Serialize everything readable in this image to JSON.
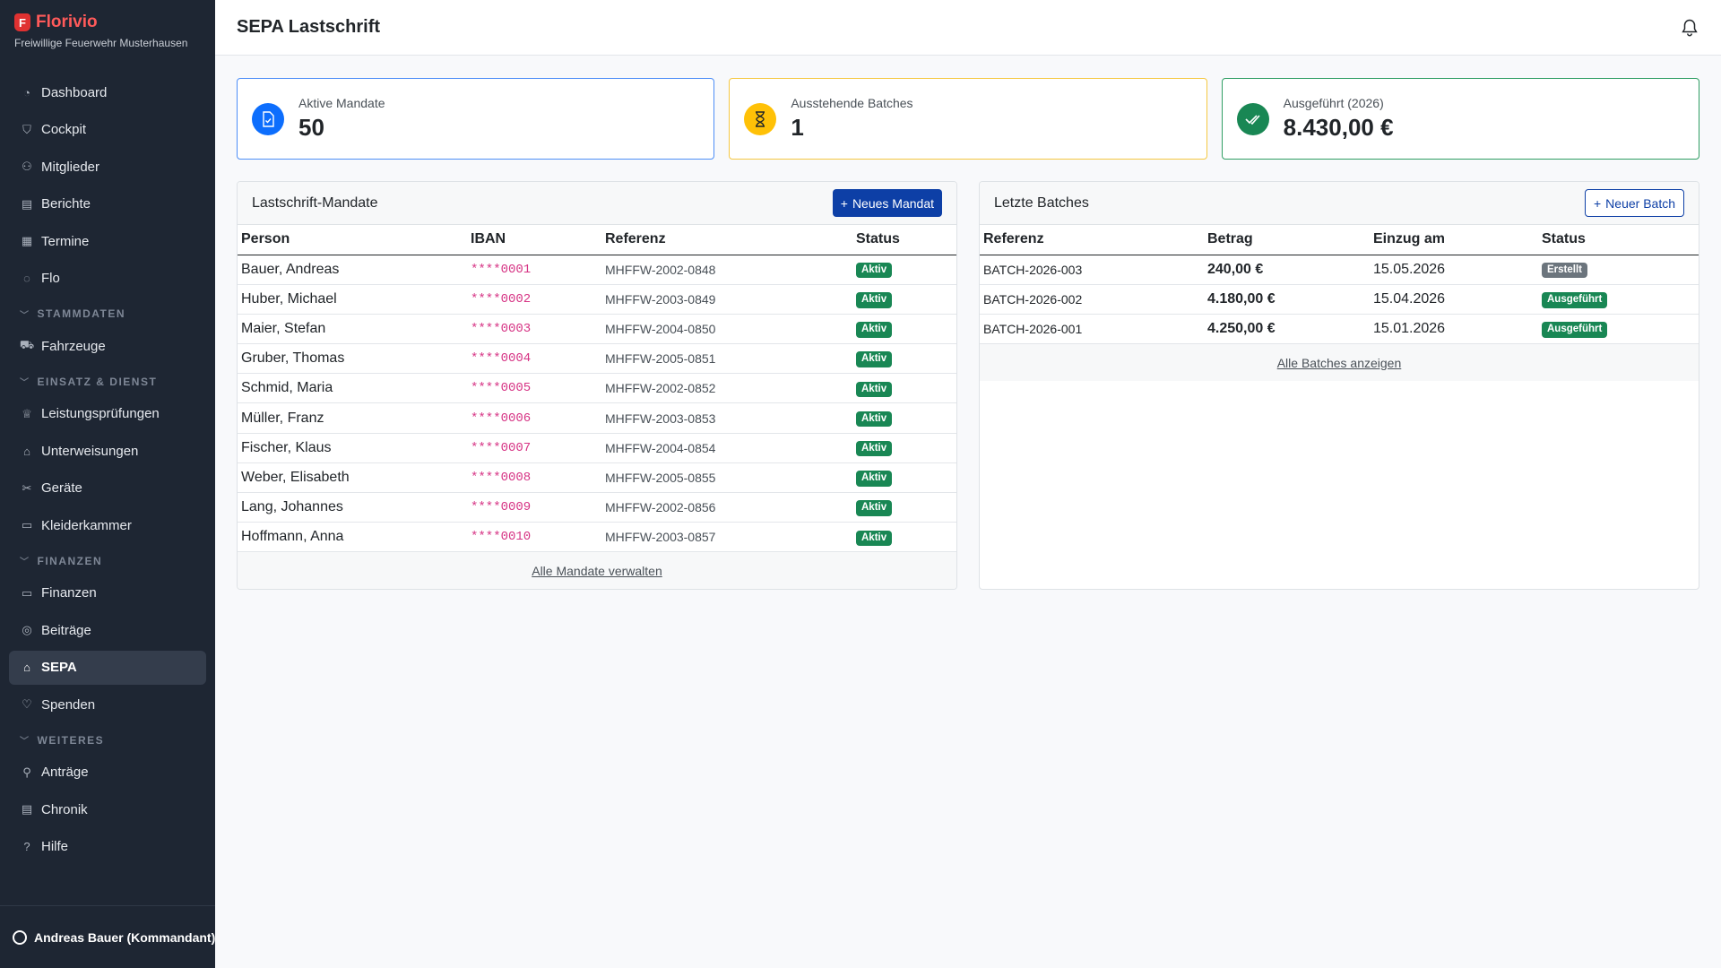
{
  "brand": {
    "name": "Florivio",
    "logo_letter": "F",
    "subtitle": "Freiwillige Feuerwehr Musterhausen"
  },
  "sidebar": {
    "items_top": [
      {
        "label": "Dashboard",
        "icon": "gauge-icon"
      },
      {
        "label": "Cockpit",
        "icon": "shield-icon"
      },
      {
        "label": "Mitglieder",
        "icon": "people-icon"
      },
      {
        "label": "Berichte",
        "icon": "document-icon"
      },
      {
        "label": "Termine",
        "icon": "calendar-icon"
      },
      {
        "label": "Flo",
        "icon": "chat-icon"
      }
    ],
    "section_stammdaten": "STAMMDATEN",
    "items_stammdaten": [
      {
        "label": "Fahrzeuge",
        "icon": "truck-icon"
      }
    ],
    "section_einsatz": "EINSATZ & DIENST",
    "items_einsatz": [
      {
        "label": "Leistungsprüfungen",
        "icon": "trophy-icon"
      },
      {
        "label": "Unterweisungen",
        "icon": "graduation-icon"
      },
      {
        "label": "Geräte",
        "icon": "tools-icon"
      },
      {
        "label": "Kleiderkammer",
        "icon": "box-icon"
      }
    ],
    "section_finanzen": "FINANZEN",
    "items_finanzen": [
      {
        "label": "Finanzen",
        "icon": "wallet-icon"
      },
      {
        "label": "Beiträge",
        "icon": "coins-icon"
      },
      {
        "label": "SEPA",
        "icon": "bank-icon",
        "active": true
      },
      {
        "label": "Spenden",
        "icon": "heart-icon"
      }
    ],
    "section_weiteres": "WEITERES",
    "items_weiteres": [
      {
        "label": "Anträge",
        "icon": "person-add-icon"
      },
      {
        "label": "Chronik",
        "icon": "journal-icon"
      },
      {
        "label": "Hilfe",
        "icon": "question-icon"
      }
    ],
    "user": "Andreas Bauer (Kommandant)"
  },
  "header": {
    "title": "SEPA Lastschrift"
  },
  "stats": [
    {
      "label": "Aktive Mandate",
      "value": "50",
      "color": "#0d6efd"
    },
    {
      "label": "Ausstehende Batches",
      "value": "1",
      "color": "#ffc107"
    },
    {
      "label": "Ausgeführt (2026)",
      "value": "8.430,00 €",
      "color": "#198754"
    }
  ],
  "mandates": {
    "title": "Lastschrift-Mandate",
    "new_button": "Neues Mandat",
    "columns": [
      "Person",
      "IBAN",
      "Referenz",
      "Status"
    ],
    "rows": [
      [
        "Bauer, Andreas",
        "****0001",
        "MHFFW-2002-0848",
        "Aktiv"
      ],
      [
        "Huber, Michael",
        "****0002",
        "MHFFW-2003-0849",
        "Aktiv"
      ],
      [
        "Maier, Stefan",
        "****0003",
        "MHFFW-2004-0850",
        "Aktiv"
      ],
      [
        "Gruber, Thomas",
        "****0004",
        "MHFFW-2005-0851",
        "Aktiv"
      ],
      [
        "Schmid, Maria",
        "****0005",
        "MHFFW-2002-0852",
        "Aktiv"
      ],
      [
        "Müller, Franz",
        "****0006",
        "MHFFW-2003-0853",
        "Aktiv"
      ],
      [
        "Fischer, Klaus",
        "****0007",
        "MHFFW-2004-0854",
        "Aktiv"
      ],
      [
        "Weber, Elisabeth",
        "****0008",
        "MHFFW-2005-0855",
        "Aktiv"
      ],
      [
        "Lang, Johannes",
        "****0009",
        "MHFFW-2002-0856",
        "Aktiv"
      ],
      [
        "Hoffmann, Anna",
        "****0010",
        "MHFFW-2003-0857",
        "Aktiv"
      ]
    ],
    "footer_link": "Alle Mandate verwalten"
  },
  "batches": {
    "title": "Letzte Batches",
    "new_button": "Neuer Batch",
    "columns": [
      "Referenz",
      "Betrag",
      "Einzug am",
      "Status"
    ],
    "rows": [
      [
        "BATCH-2026-003",
        "240,00 €",
        "15.05.2026",
        "Erstellt"
      ],
      [
        "BATCH-2026-002",
        "4.180,00 €",
        "15.04.2026",
        "Ausgeführt"
      ],
      [
        "BATCH-2026-001",
        "4.250,00 €",
        "15.01.2026",
        "Ausgeführt"
      ]
    ],
    "footer_link": "Alle Batches anzeigen"
  }
}
